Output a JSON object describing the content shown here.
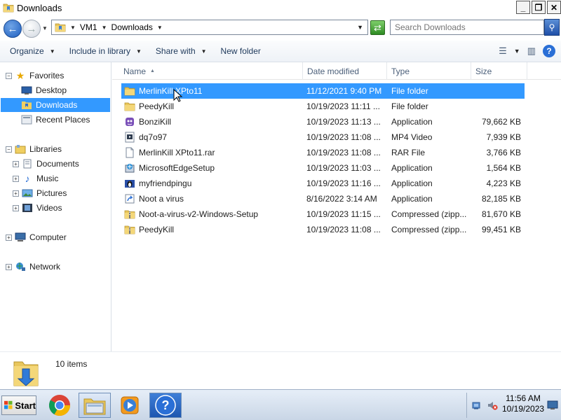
{
  "window": {
    "title": "Downloads"
  },
  "address": {
    "crumbs": [
      "VM1",
      "Downloads"
    ]
  },
  "search": {
    "placeholder": "Search Downloads"
  },
  "toolbar": {
    "organize": "Organize",
    "include_in_library": "Include in library",
    "share_with": "Share with",
    "new_folder": "New folder"
  },
  "nav": {
    "favorites": "Favorites",
    "desktop": "Desktop",
    "downloads": "Downloads",
    "recent_places": "Recent Places",
    "libraries": "Libraries",
    "documents": "Documents",
    "music": "Music",
    "pictures": "Pictures",
    "videos": "Videos",
    "computer": "Computer",
    "network": "Network"
  },
  "columns": {
    "name": "Name",
    "date_modified": "Date modified",
    "type": "Type",
    "size": "Size"
  },
  "files": [
    {
      "name": "MerlinKill XPto11",
      "date": "11/12/2021 9:40 PM",
      "type": "File folder",
      "size": "",
      "icon": "folder-icon"
    },
    {
      "name": "PeedyKill",
      "date": "10/19/2023 11:11 ...",
      "type": "File folder",
      "size": "",
      "icon": "folder-icon"
    },
    {
      "name": "BonziKill",
      "date": "10/19/2023 11:13 ...",
      "type": "Application",
      "size": "79,662 KB",
      "icon": "bonzi-app-icon"
    },
    {
      "name": "dq7o97",
      "date": "10/19/2023 11:08 ...",
      "type": "MP4 Video",
      "size": "7,939 KB",
      "icon": "video-file-icon"
    },
    {
      "name": "MerlinKill XPto11.rar",
      "date": "10/19/2023 11:08 ...",
      "type": "RAR File",
      "size": "3,766 KB",
      "icon": "blank-file-icon"
    },
    {
      "name": "MicrosoftEdgeSetup",
      "date": "10/19/2023 11:03 ...",
      "type": "Application",
      "size": "1,564 KB",
      "icon": "installer-icon"
    },
    {
      "name": "myfriendpingu",
      "date": "10/19/2023 11:16 ...",
      "type": "Application",
      "size": "4,223 KB",
      "icon": "penguin-app-icon"
    },
    {
      "name": "Noot a virus",
      "date": "8/16/2022 3:14 AM",
      "type": "Application",
      "size": "82,185 KB",
      "icon": "shortcut-app-icon"
    },
    {
      "name": "Noot-a-virus-v2-Windows-Setup",
      "date": "10/19/2023 11:15 ...",
      "type": "Compressed (zipp...",
      "size": "81,670 KB",
      "icon": "zip-folder-icon"
    },
    {
      "name": "PeedyKill",
      "date": "10/19/2023 11:08 ...",
      "type": "Compressed (zipp...",
      "size": "99,451 KB",
      "icon": "zip-folder-icon"
    }
  ],
  "status": {
    "item_count": "10 items"
  },
  "taskbar": {
    "start": "Start",
    "time": "11:56 AM",
    "date": "10/19/2023"
  }
}
